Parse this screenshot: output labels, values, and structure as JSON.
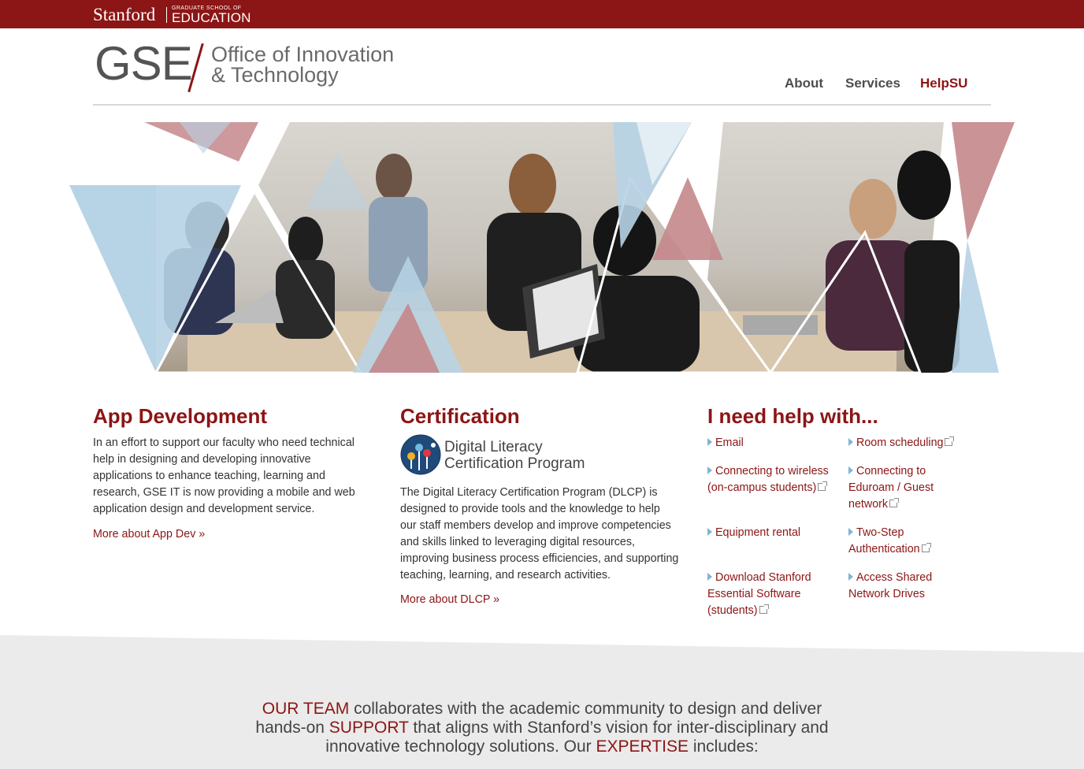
{
  "topbar": {
    "stanford": "Stanford",
    "school_small": "GRADUATE SCHOOL OF",
    "school": "EDUCATION"
  },
  "logo": {
    "gse": "GSE",
    "line1": "Office of Innovation",
    "line2": "& Technology"
  },
  "nav": {
    "about": "About",
    "services": "Services",
    "helpsu": "HelpSU"
  },
  "sections": {
    "app": {
      "title": "App Development",
      "lines": [
        "In an effort to support our faculty who need technical",
        "help in designing and developing innovative",
        "applications to enhance teaching, learning and",
        "research, GSE IT is now providing a mobile and web",
        "application design and development service."
      ],
      "more": "More about App Dev »"
    },
    "cert": {
      "title": "Certification",
      "logo_line1": "Digital Literacy",
      "logo_line2": "Certification Program",
      "lines": [
        "The Digital Literacy Certification Program (DLCP) is",
        "designed to provide tools and the knowledge to help",
        "our staff members develop and improve competencies",
        "and skills linked to leveraging digital resources,",
        "improving business process efficiencies, and supporting",
        "teaching, learning, and research activities."
      ],
      "more": "More about DLCP »"
    },
    "help": {
      "title": "I need help with...",
      "links": [
        {
          "lines": [
            "Email"
          ],
          "external": false
        },
        {
          "lines": [
            "Room scheduling"
          ],
          "external": true
        },
        {
          "lines": [
            "Connecting to wireless",
            "(on-campus students)"
          ],
          "external": true
        },
        {
          "lines": [
            "Connecting to",
            "Eduroam / Guest",
            "network"
          ],
          "external": true
        },
        {
          "lines": [
            "Equipment rental"
          ],
          "external": false
        },
        {
          "lines": [
            "Two-Step",
            "Authentication"
          ],
          "external": true
        },
        {
          "lines": [
            "Download Stanford",
            "Essential Software",
            "(students)"
          ],
          "external": true
        },
        {
          "lines": [
            "Access Shared",
            "Network Drives"
          ],
          "external": false
        }
      ]
    }
  },
  "team": {
    "p1": "OUR TEAM",
    "t1": " collaborates with the academic community to design and deliver",
    "t2": "hands-on ",
    "p2": "SUPPORT",
    "t3": " that aligns with Stanford’s vision for inter-disciplinary and",
    "t4": "innovative technology solutions. Our ",
    "p3": "EXPERTISE",
    "t5": " includes:"
  },
  "colors": {
    "cardinal": "#8c1515",
    "light_blue": "#b7d3e6",
    "rose": "#c4878b"
  }
}
